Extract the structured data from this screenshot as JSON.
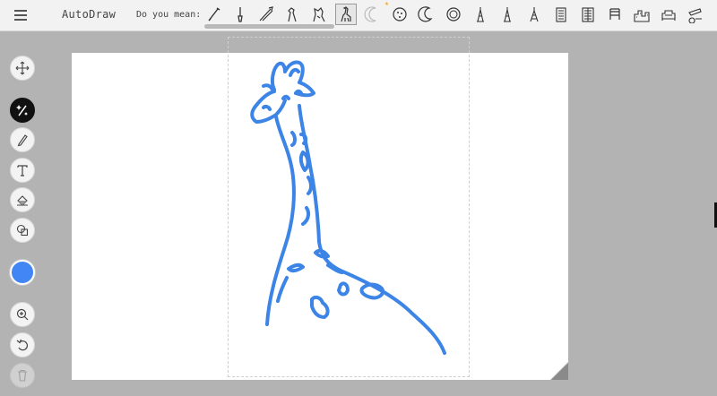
{
  "app": {
    "title": "AutoDraw"
  },
  "header": {
    "menu_icon": "hamburger-menu-icon",
    "suggestions_label": "Do you mean:",
    "suggestions": [
      {
        "icon": "paintbrush-icon"
      },
      {
        "icon": "brush-icon"
      },
      {
        "icon": "tools-icon"
      },
      {
        "icon": "giraffe-head-icon"
      },
      {
        "icon": "animal-icon"
      },
      {
        "icon": "giraffe-icon",
        "selected": true
      },
      {
        "icon": "crescent-moon-icon",
        "highlighted": true
      },
      {
        "icon": "cookie-icon"
      },
      {
        "icon": "moon-icon"
      },
      {
        "icon": "round-face-icon"
      },
      {
        "icon": "eiffel-tower-icon"
      },
      {
        "icon": "eiffel-tower-icon"
      },
      {
        "icon": "eiffel-tower-icon"
      },
      {
        "icon": "building-icon"
      },
      {
        "icon": "building-icon"
      },
      {
        "icon": "chair-icon"
      },
      {
        "icon": "city-icon"
      },
      {
        "icon": "sofa-icon"
      },
      {
        "icon": "cannon-icon"
      }
    ]
  },
  "toolbar": {
    "tools": [
      {
        "icon": "move-icon"
      },
      {
        "icon": "autodraw-icon",
        "active": true
      },
      {
        "icon": "pencil-icon"
      },
      {
        "icon": "text-icon"
      },
      {
        "icon": "fill-icon"
      },
      {
        "icon": "shape-icon"
      },
      {
        "icon": "zoom-in-icon"
      },
      {
        "icon": "undo-icon"
      },
      {
        "icon": "trash-icon",
        "disabled": true
      }
    ],
    "color": "#4285f4"
  },
  "colors": {
    "stroke": "#3c84e6",
    "accent": "#f7a823"
  }
}
